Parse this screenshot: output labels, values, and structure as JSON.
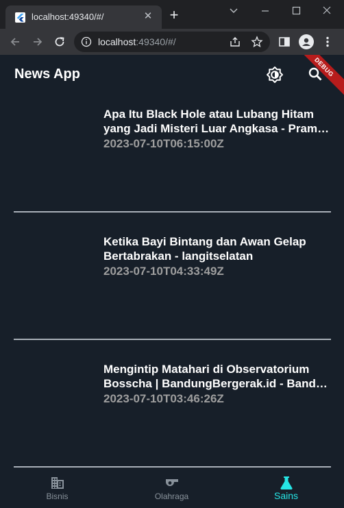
{
  "browser": {
    "tab_title": "localhost:49340/#/",
    "url_host": "localhost",
    "url_rest": ":49340/#/"
  },
  "app": {
    "title": "News App",
    "debug_label": "DEBUG"
  },
  "news": [
    {
      "title_line1": "Apa Itu Black Hole atau Lubang Hitam",
      "title_line2": "yang Jadi Misteri Luar Angkasa - Prambors",
      "date": "2023-07-10T06:15:00Z"
    },
    {
      "title_line1": "Ketika Bayi Bintang dan Awan Gelap",
      "title_line2": "Bertabrakan - langitselatan",
      "date": "2023-07-10T04:33:49Z"
    },
    {
      "title_line1": "Mengintip Matahari di Observatorium",
      "title_line2": "Bosscha | BandungBergerak.id - Bandung",
      "date": "2023-07-10T03:46:26Z"
    }
  ],
  "bottom_nav": [
    {
      "label": "Bisnis",
      "icon": "business-icon",
      "active": false
    },
    {
      "label": "Olahraga",
      "icon": "whistle-icon",
      "active": false
    },
    {
      "label": "Sains",
      "icon": "flask-icon",
      "active": true
    }
  ],
  "colors": {
    "background": "#171f29",
    "accent": "#26e6e6",
    "date_text": "#9e9e9e"
  }
}
